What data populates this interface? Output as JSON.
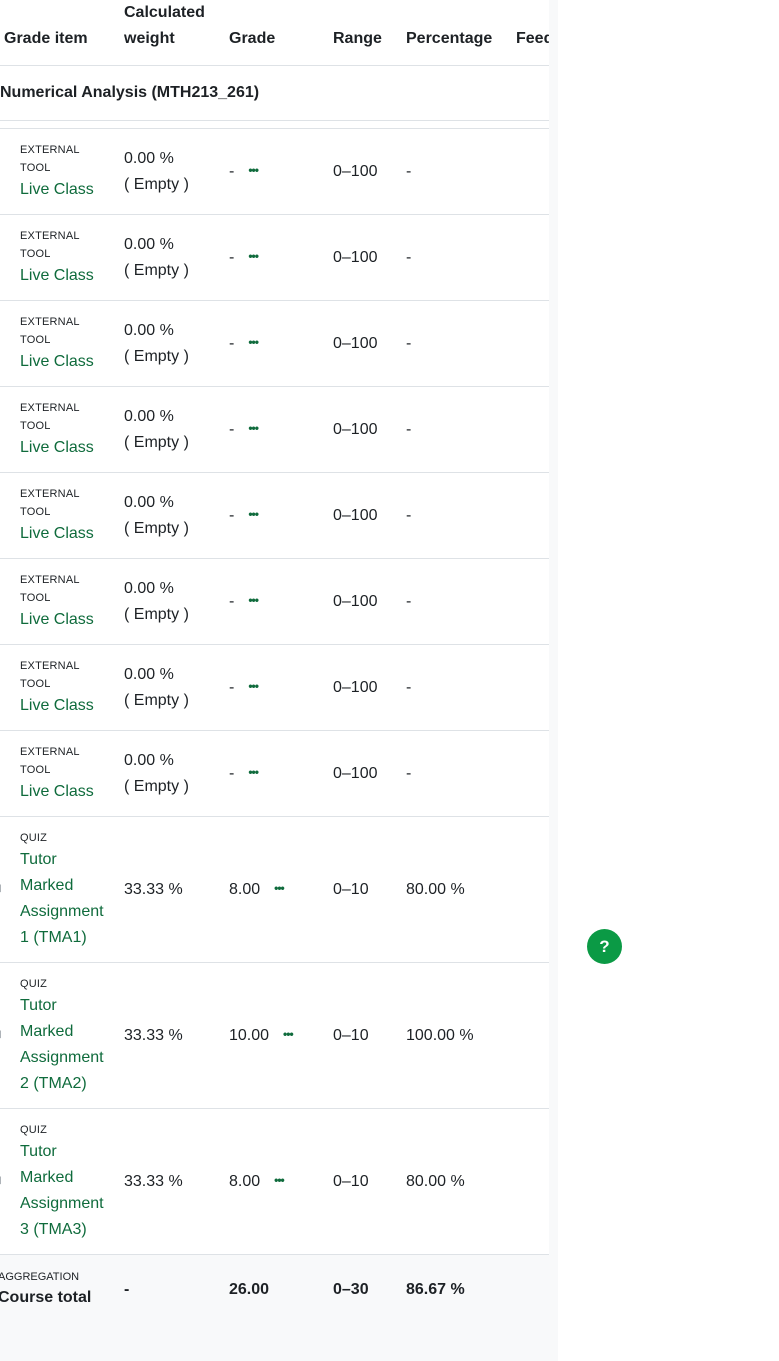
{
  "columns": {
    "item": "Grade item",
    "weight_line1": "Calculated",
    "weight_line2": "weight",
    "grade": "Grade",
    "range": "Range",
    "percentage": "Percentage",
    "feedback": "Feedback"
  },
  "category": {
    "name": "Numerical Analysis (MTH213_261)"
  },
  "rows": [
    {
      "type": "EXTERNAL TOOL",
      "name": "Live Class",
      "icon": "puzzle-icon",
      "weight": "0.00 %",
      "weight_note": "( Empty )",
      "grade": "-",
      "range": "0–100",
      "percentage": "-"
    },
    {
      "type": "EXTERNAL TOOL",
      "name": "Live Class",
      "icon": "puzzle-icon",
      "weight": "0.00 %",
      "weight_note": "( Empty )",
      "grade": "-",
      "range": "0–100",
      "percentage": "-"
    },
    {
      "type": "EXTERNAL TOOL",
      "name": "Live Class",
      "icon": "puzzle-icon",
      "weight": "0.00 %",
      "weight_note": "( Empty )",
      "grade": "-",
      "range": "0–100",
      "percentage": "-"
    },
    {
      "type": "EXTERNAL TOOL",
      "name": "Live Class",
      "icon": "puzzle-icon",
      "weight": "0.00 %",
      "weight_note": "( Empty )",
      "grade": "-",
      "range": "0–100",
      "percentage": "-"
    },
    {
      "type": "EXTERNAL TOOL",
      "name": "Live Class",
      "icon": "puzzle-icon",
      "weight": "0.00 %",
      "weight_note": "( Empty )",
      "grade": "-",
      "range": "0–100",
      "percentage": "-"
    },
    {
      "type": "EXTERNAL TOOL",
      "name": "Live Class",
      "icon": "puzzle-icon",
      "weight": "0.00 %",
      "weight_note": "( Empty )",
      "grade": "-",
      "range": "0–100",
      "percentage": "-"
    },
    {
      "type": "EXTERNAL TOOL",
      "name": "Live Class",
      "icon": "puzzle-icon",
      "weight": "0.00 %",
      "weight_note": "( Empty )",
      "grade": "-",
      "range": "0–100",
      "percentage": "-"
    },
    {
      "type": "EXTERNAL TOOL",
      "name": "Live Class",
      "icon": "puzzle-icon",
      "weight": "0.00 %",
      "weight_note": "( Empty )",
      "grade": "-",
      "range": "0–100",
      "percentage": "-"
    },
    {
      "type": "QUIZ",
      "name": "Tutor Marked Assignment 1 (TMA1)",
      "icon": "quiz-icon",
      "weight": "33.33 %",
      "weight_note": "",
      "grade": "8.00",
      "range": "0–10",
      "percentage": "80.00 %"
    },
    {
      "type": "QUIZ",
      "name": "Tutor Marked Assignment 2 (TMA2)",
      "icon": "quiz-icon",
      "weight": "33.33 %",
      "weight_note": "",
      "grade": "10.00",
      "range": "0–10",
      "percentage": "100.00 %"
    },
    {
      "type": "QUIZ",
      "name": "Tutor Marked Assignment 3 (TMA3)",
      "icon": "quiz-icon",
      "weight": "33.33 %",
      "weight_note": "",
      "grade": "8.00",
      "range": "0–10",
      "percentage": "80.00 %"
    }
  ],
  "actions_glyph": "•••",
  "total": {
    "type": "AGGREGATION",
    "label": "Course total",
    "weight": "-",
    "grade": "26.00",
    "range": "0–30",
    "percentage": "86.67 %"
  },
  "help_button": {
    "label": "?",
    "color": "#0b9a45"
  },
  "colors": {
    "link": "#0f6b3c",
    "border": "#dee2e6",
    "panel": "#f8f9fa"
  }
}
